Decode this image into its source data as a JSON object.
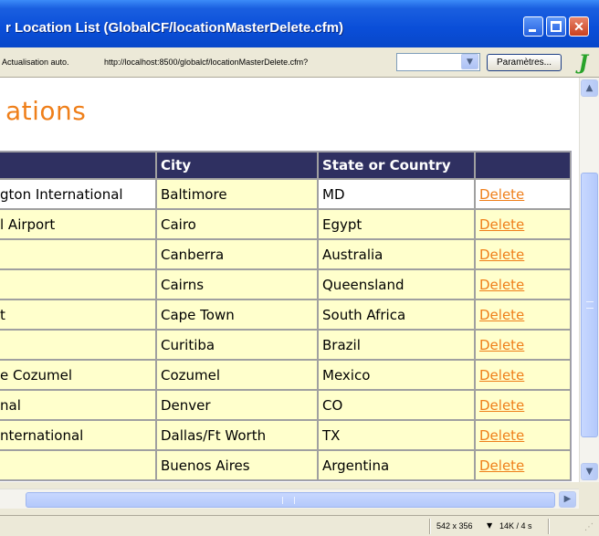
{
  "window": {
    "title": "r Location List (GlobalCF/locationMasterDelete.cfm)"
  },
  "toolbar": {
    "auto_refresh_label": "Actualisation auto.",
    "url": "http://localhost:8500/globalcf/locationMasterDelete.cfm?",
    "dropdown_icon": "chevron-down-icon",
    "params_label": "Paramètres...",
    "app_icon": "jet-check-icon",
    "app_glyph": "J"
  },
  "page": {
    "heading": "ations"
  },
  "table": {
    "headers": [
      "",
      "City",
      "State or Country",
      ""
    ],
    "rows": [
      {
        "airport": "gton International",
        "city": "Baltimore",
        "state": "MD",
        "action": "Delete"
      },
      {
        "airport": "l Airport",
        "city": "Cairo",
        "state": "Egypt",
        "action": "Delete"
      },
      {
        "airport": "",
        "city": "Canberra",
        "state": "Australia",
        "action": "Delete"
      },
      {
        "airport": "",
        "city": "Cairns",
        "state": "Queensland",
        "action": "Delete"
      },
      {
        "airport": "t",
        "city": "Cape Town",
        "state": "South Africa",
        "action": "Delete"
      },
      {
        "airport": "",
        "city": "Curitiba",
        "state": "Brazil",
        "action": "Delete"
      },
      {
        "airport": "e Cozumel",
        "city": "Cozumel",
        "state": "Mexico",
        "action": "Delete"
      },
      {
        "airport": "nal",
        "city": "Denver",
        "state": "CO",
        "action": "Delete"
      },
      {
        "airport": "nternational",
        "city": "Dallas/Ft Worth",
        "state": "TX",
        "action": "Delete"
      },
      {
        "airport": "",
        "city": "Buenos Aires",
        "state": "Argentina",
        "action": "Delete"
      }
    ]
  },
  "status": {
    "size": "542 x 356",
    "weight": "14K / 4 s"
  },
  "colors": {
    "title_bar": "#0a4ed8",
    "header_bg": "#2f3061",
    "row_bg": "#ffffcc",
    "accent": "#ef7f1a"
  }
}
